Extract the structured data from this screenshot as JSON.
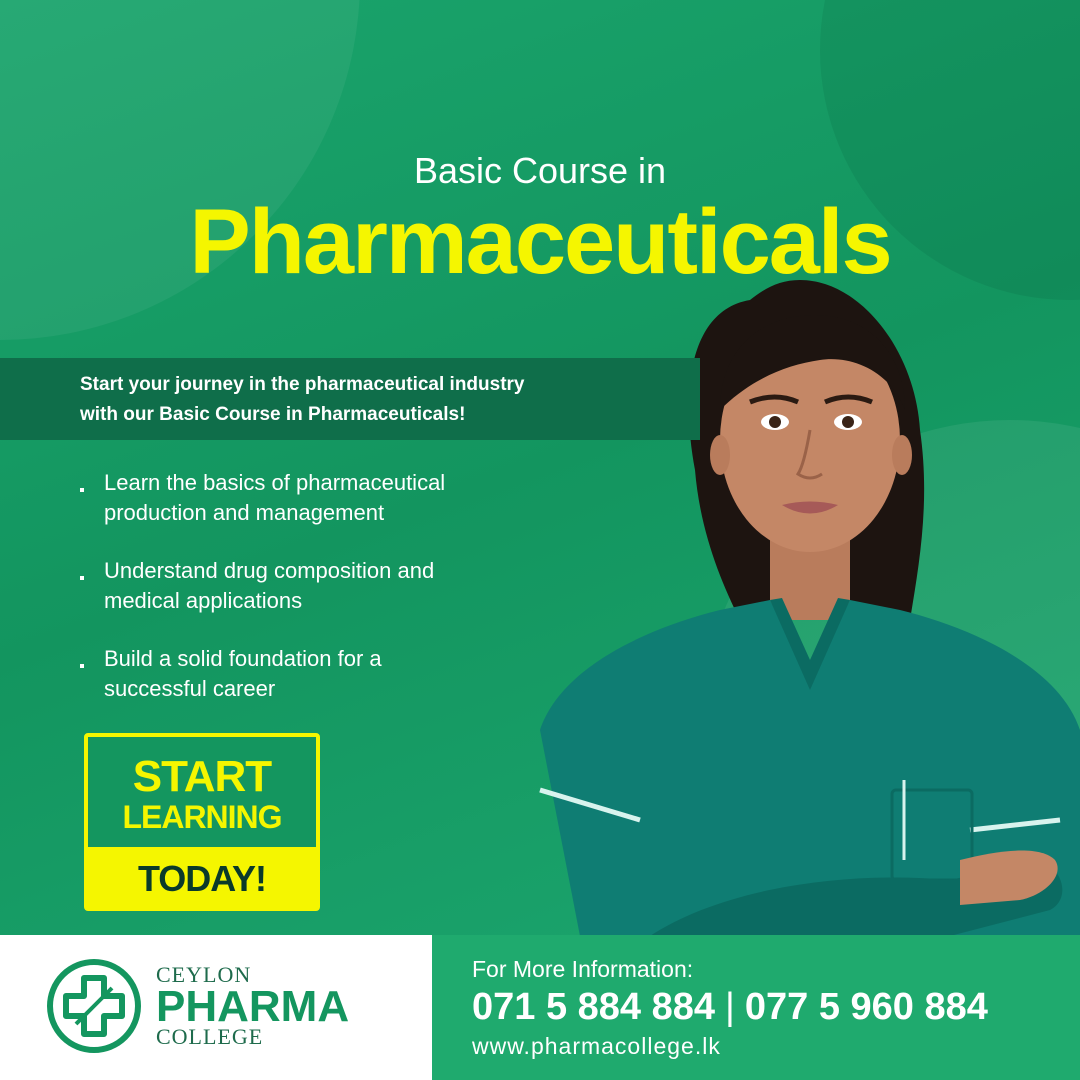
{
  "headline": {
    "prefix": "Basic Course in",
    "main": "Pharmaceuticals"
  },
  "intro": {
    "line1": "Start your journey in the pharmaceutical industry",
    "line2": "with our Basic Course in Pharmaceuticals!"
  },
  "bullets": [
    {
      "line1": "Learn the basics of pharmaceutical",
      "line2": "production and management"
    },
    {
      "line1": "Understand drug composition and",
      "line2": "medical applications"
    },
    {
      "line1": "Build a solid foundation for a",
      "line2": "successful career"
    }
  ],
  "cta": {
    "line1": "START",
    "line2": "LEARNING",
    "line3": "TODAY!"
  },
  "logo": {
    "top": "CEYLON",
    "main": "PHARMA",
    "bottom": "COLLEGE"
  },
  "contact": {
    "label": "For More Information:",
    "phone1": "071 5 884 884",
    "separator": "|",
    "phone2": "077 5 960 884",
    "website": "www.pharmacollege.lk"
  },
  "colors": {
    "brand_green": "#14965f",
    "dark_green": "#0f6e4a",
    "accent_yellow": "#f5f600",
    "scrubs_teal": "#0f7d73"
  },
  "icons": {
    "logo": "medical-cross-icon",
    "bullet": "square-bullet-icon"
  }
}
